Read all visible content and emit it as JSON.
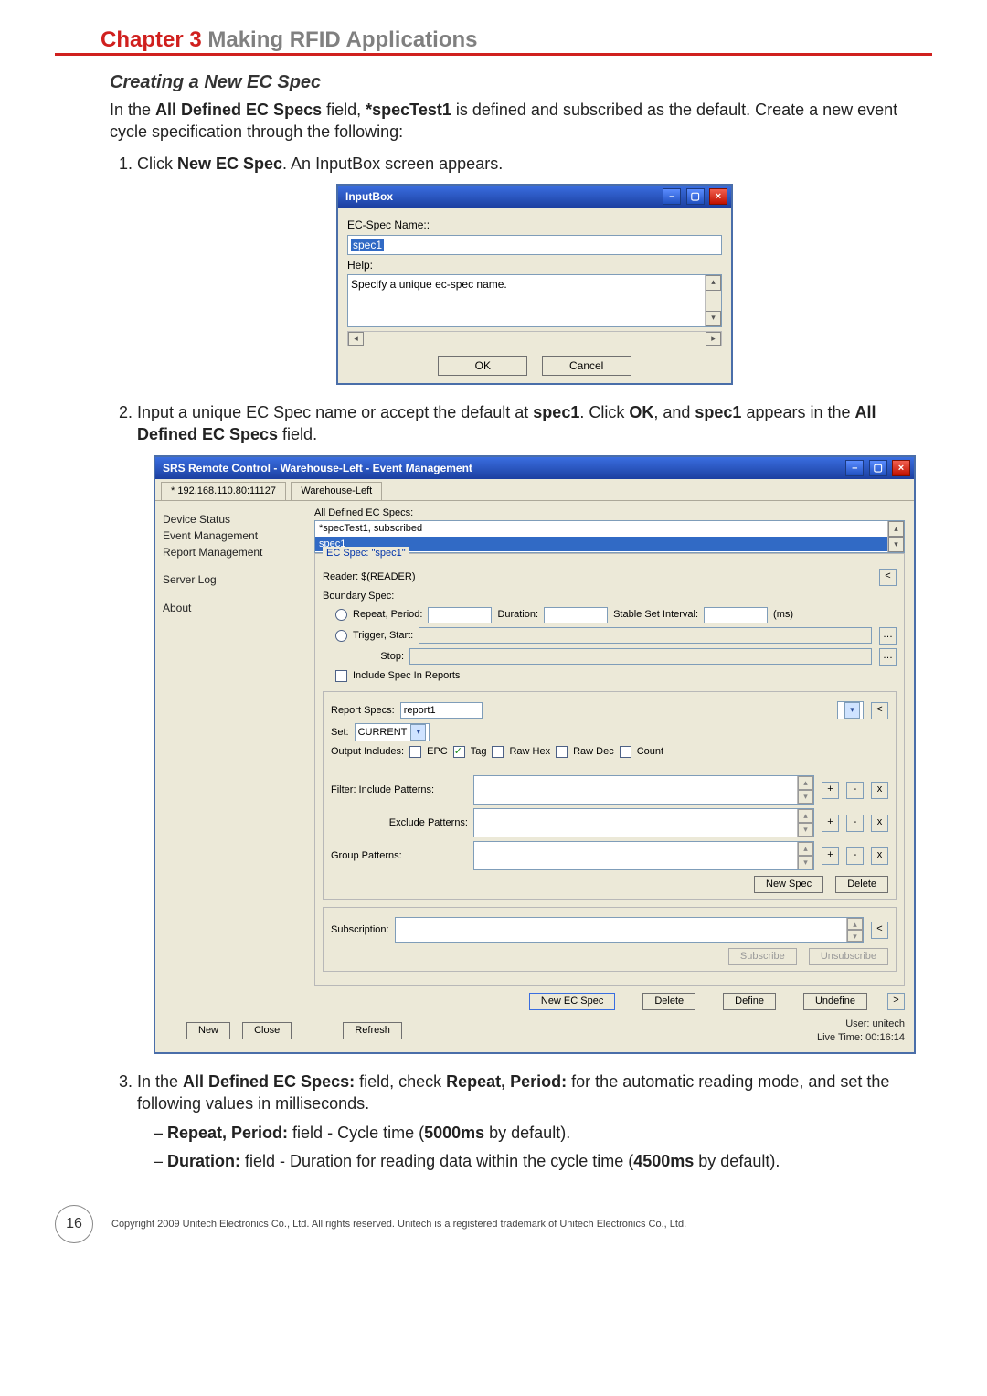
{
  "chapter": {
    "label": "Chapter 3",
    "title": " Making RFID Applications"
  },
  "section_title": "Creating a New EC Spec",
  "intro_p1a": "In the ",
  "intro_p1b": "All Defined EC Specs",
  "intro_p1c": " field, ",
  "intro_p1d": "*specTest1",
  "intro_p1e": " is defined and subscribed as the default. Create a new event cycle specification through the following:",
  "step1a": "Click ",
  "step1b": "New EC Spec",
  "step1c": ". An InputBox screen appears.",
  "inputbox": {
    "title": "InputBox",
    "ecspec_label": "EC-Spec Name::",
    "ecspec_value": "spec1",
    "help_label": "Help:",
    "help_text": "Specify a unique ec-spec name.",
    "ok": "OK",
    "cancel": "Cancel",
    "min": "–",
    "max": "▢",
    "close": "×"
  },
  "step2a": "Input a unique EC Spec name or accept the default at ",
  "step2b": "spec1",
  "step2c": ". Click ",
  "step2d": "OK",
  "step2e": ", and ",
  "step2f": "spec1",
  "step2g": " appears in the ",
  "step2h": "All Defined EC Specs",
  "step2i": " field.",
  "srs": {
    "title": "SRS Remote Control - Warehouse-Left - Event Management",
    "tab1": "* 192.168.110.80:11127",
    "tab2": "Warehouse-Left",
    "nav": {
      "device": "Device Status",
      "event": "Event Management",
      "report": "Report Management",
      "server": "Server Log",
      "about": "About"
    },
    "all_defined_label": "All Defined EC Specs:",
    "list_line1": "*specTest1, subscribed",
    "list_line2": "spec1",
    "ecspec_legend": "EC Spec: \"spec1\"",
    "reader": "Reader: $(READER)",
    "boundary": "Boundary Spec:",
    "repeat": "Repeat, Period:",
    "duration": "Duration:",
    "stable": "Stable Set Interval:",
    "ms": "(ms)",
    "trigger": "Trigger, Start:",
    "stop": "Stop:",
    "include_spec": "Include Spec In Reports",
    "report_specs": "Report Specs:",
    "report_specs_val": "report1",
    "set": "Set:",
    "set_val": "CURRENT",
    "output_includes": "Output Includes:",
    "o_epc": "EPC",
    "o_tag": "Tag",
    "o_rawhex": "Raw Hex",
    "o_rawdec": "Raw Dec",
    "o_count": "Count",
    "f_include": "Filter: Include Patterns:",
    "f_exclude": "Exclude Patterns:",
    "f_group": "Group Patterns:",
    "new_spec": "New Spec",
    "delete_spec": "Delete",
    "subscription": "Subscription:",
    "subscribe": "Subscribe",
    "unsubscribe": "Unsubscribe",
    "new_ec_spec": "New EC Spec",
    "delete": "Delete",
    "define": "Define",
    "undefine": "Undefine",
    "new": "New",
    "close": "Close",
    "refresh": "Refresh",
    "user": "User: unitech",
    "live": "Live Time: 00:16:14",
    "min": "–",
    "max": "▢",
    "closebtn": "×",
    "plus": "+",
    "minus": "-",
    "xbtn": "x",
    "lt": "<",
    "gt": ">",
    "dd": "▾"
  },
  "step3a": "In the ",
  "step3b": "All Defined EC Specs:",
  "step3c": " field, check ",
  "step3d": "Repeat, Period:",
  "step3e": " for the automatic reading mode, and set the following values in milliseconds.",
  "b1a": "Repeat, Period:",
  "b1b": " field - Cycle time (",
  "b1c": "5000ms",
  "b1d": " by default).",
  "b2a": "Duration:",
  "b2b": " field - Duration for reading data within the cycle time (",
  "b2c": "4500ms",
  "b2d": " by default).",
  "page_number": "16",
  "copyright": "Copyright 2009 Unitech Electronics Co., Ltd. All rights reserved. Unitech is a registered trademark of Unitech Electronics Co., Ltd."
}
